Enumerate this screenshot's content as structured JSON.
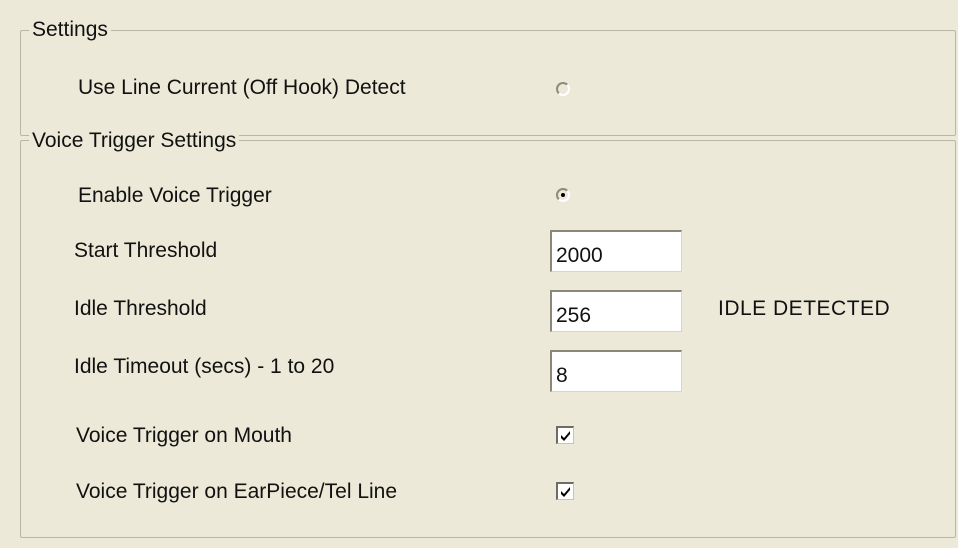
{
  "settings_group": {
    "legend": "Settings",
    "off_hook": {
      "label": "Use Line Current (Off Hook) Detect",
      "selected": false
    }
  },
  "voice_group": {
    "legend": "Voice Trigger Settings",
    "enable": {
      "label": "Enable Voice Trigger",
      "selected": true
    },
    "start_threshold": {
      "label": "Start Threshold",
      "value": "2000"
    },
    "idle_threshold": {
      "label": "Idle Threshold",
      "value": "256"
    },
    "idle_status": "IDLE DETECTED",
    "idle_timeout": {
      "label": "Idle Timeout (secs) - 1 to 20",
      "value": "8"
    },
    "mouth": {
      "label": "Voice Trigger on Mouth",
      "checked": true
    },
    "earpiece": {
      "label": "Voice Trigger on EarPiece/Tel Line",
      "checked": true
    }
  }
}
